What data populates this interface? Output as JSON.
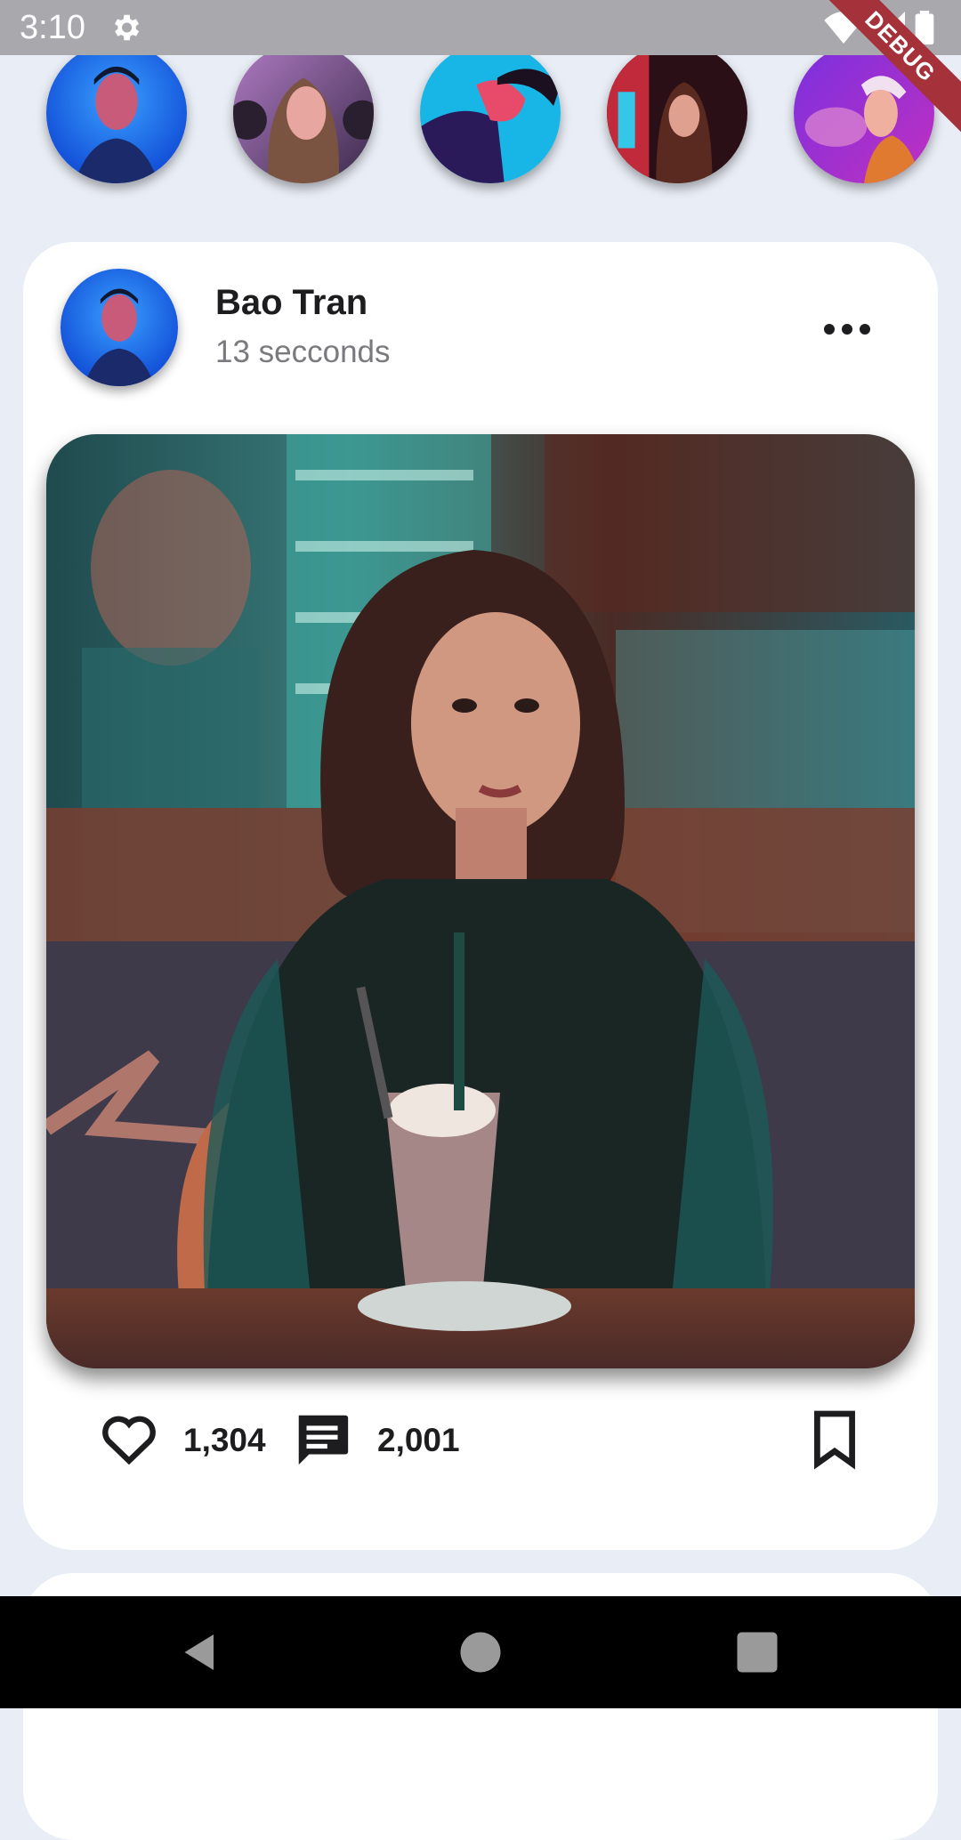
{
  "status_bar": {
    "time": "3:10",
    "icons": [
      "settings-icon",
      "wifi-icon",
      "signal-icon",
      "battery-icon"
    ],
    "debug_label": "DEBUG"
  },
  "stories": [
    {
      "name": "story-1",
      "theme": "blue"
    },
    {
      "name": "story-2",
      "theme": "pink"
    },
    {
      "name": "story-3",
      "theme": "cyan"
    },
    {
      "name": "story-4",
      "theme": "neon-red"
    },
    {
      "name": "story-5",
      "theme": "purple"
    }
  ],
  "post": {
    "author": "Bao Tran",
    "time": "13 secconds",
    "likes": "1,304",
    "comments": "2,001"
  },
  "nav": {
    "buttons": [
      "back-icon",
      "home-icon",
      "recents-icon"
    ]
  },
  "colors": {
    "background": "#e9edf5",
    "card": "#ffffff",
    "text": "#1d1d1f",
    "muted": "#7a7a7e"
  }
}
